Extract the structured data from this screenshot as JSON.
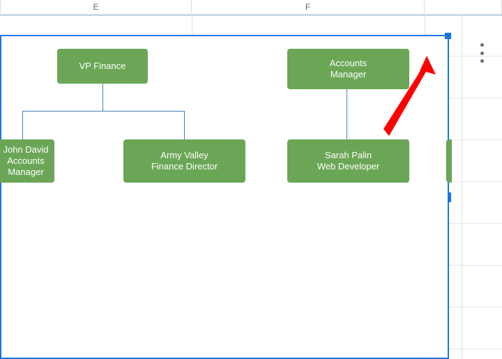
{
  "columns": {
    "e": "E",
    "f": "F"
  },
  "chart_data": {
    "type": "org",
    "nodes": [
      {
        "id": "vp_finance",
        "label": "VP Finance",
        "parent": null
      },
      {
        "id": "accounts_manager",
        "label": "Accounts\nManager",
        "parent": null
      },
      {
        "id": "john_david",
        "label": "John David\nAccounts\nManager",
        "parent": "vp_finance"
      },
      {
        "id": "army_valley",
        "label": "Army Valley\nFinance Director",
        "parent": "vp_finance"
      },
      {
        "id": "sarah_palin",
        "label": "Sarah Palin\nWeb Developer",
        "parent": "accounts_manager"
      }
    ],
    "node_color": "#6ba656",
    "connector_color": "#4a7ebb"
  },
  "annotation": {
    "kind": "arrow",
    "color": "#ff0000",
    "target": "chart-options-icon"
  }
}
